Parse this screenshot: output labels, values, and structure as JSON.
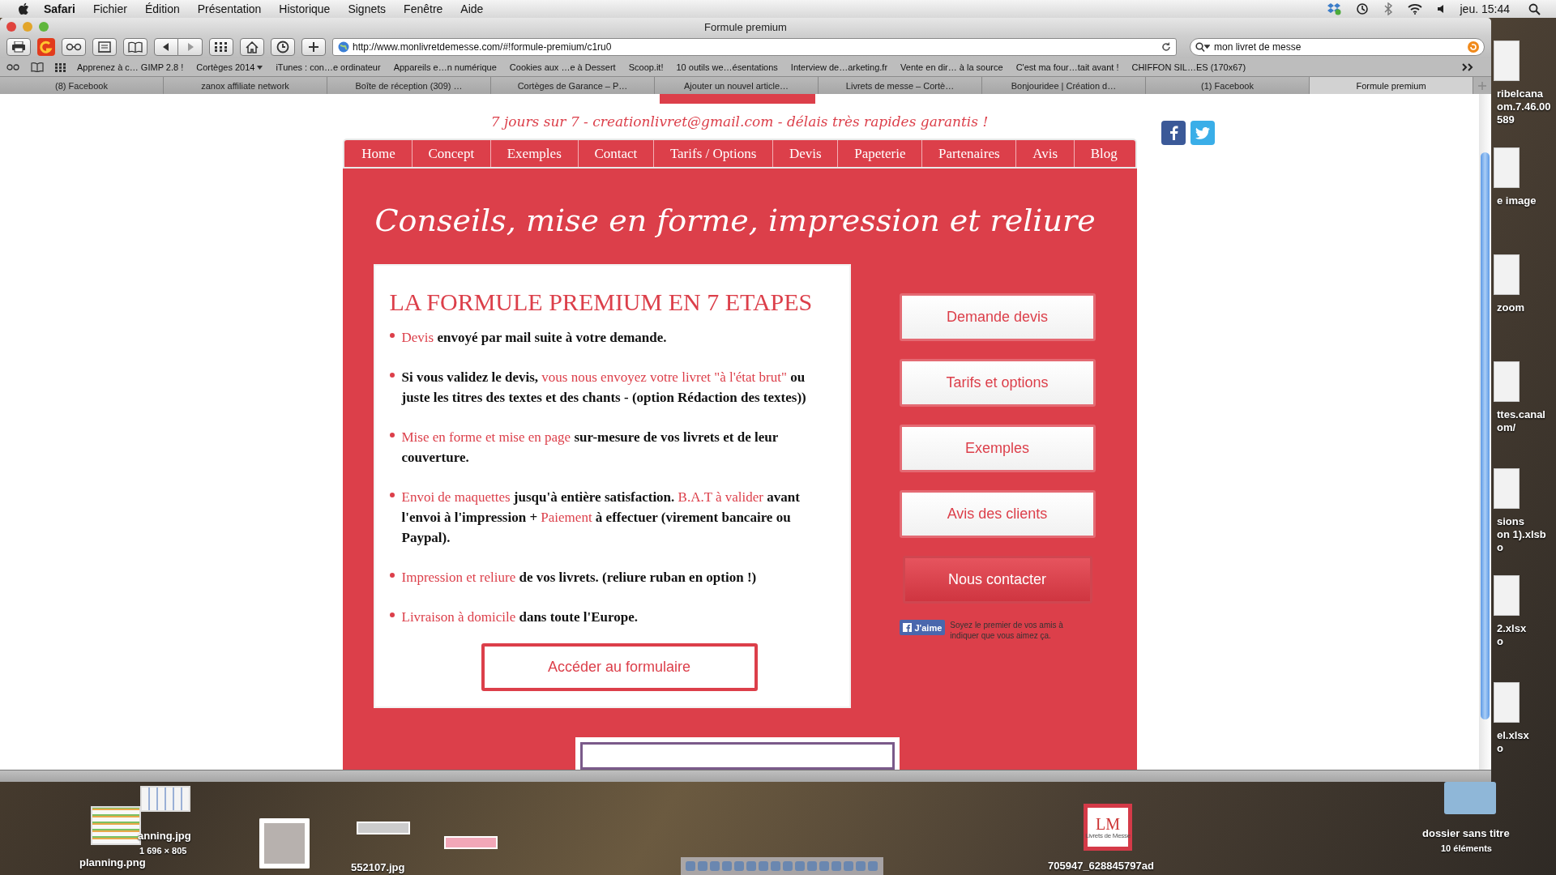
{
  "menubar": {
    "app": "Safari",
    "menus": [
      "Fichier",
      "Édition",
      "Présentation",
      "Historique",
      "Signets",
      "Fenêtre",
      "Aide"
    ],
    "clock": "jeu. 15:44"
  },
  "window": {
    "title": "Formule premium",
    "url": "http://www.monlivretdemesse.com/#!formule-premium/c1ru0",
    "search": "mon livret de messe",
    "bookmarks": [
      {
        "label": "Apprenez à c… GIMP 2.8 !",
        "folder": false
      },
      {
        "label": "Cortèges 2014",
        "folder": true
      },
      {
        "label": "iTunes : con…e ordinateur",
        "folder": false
      },
      {
        "label": "Appareils e…n numérique",
        "folder": false
      },
      {
        "label": "Cookies aux …e à Dessert",
        "folder": false
      },
      {
        "label": "Scoop.it!",
        "folder": false
      },
      {
        "label": "10 outils we…ésentations",
        "folder": false
      },
      {
        "label": "Interview de…arketing.fr",
        "folder": false
      },
      {
        "label": "Vente en dir… à la source",
        "folder": false
      },
      {
        "label": "C'est ma four…tait avant !",
        "folder": false
      },
      {
        "label": "CHIFFON SIL…ES (170x67)",
        "folder": false
      }
    ],
    "tabs": [
      {
        "label": "(8) Facebook",
        "selected": false
      },
      {
        "label": "zanox affiliate network",
        "selected": false
      },
      {
        "label": "Boîte de réception (309) …",
        "selected": false
      },
      {
        "label": "Cortèges de Garance – P…",
        "selected": false
      },
      {
        "label": "Ajouter un nouvel article…",
        "selected": false
      },
      {
        "label": "Livrets de messe – Cortè…",
        "selected": false
      },
      {
        "label": "Bonjouridee | Création d…",
        "selected": false
      },
      {
        "label": "(1) Facebook",
        "selected": false
      },
      {
        "label": "Formule premium",
        "selected": true
      }
    ]
  },
  "page": {
    "tagline": "7 jours sur 7 - creationlivret@gmail.com - délais très rapides garantis !",
    "nav": [
      "Home",
      "Concept",
      "Exemples",
      "Contact",
      "Tarifs / Options",
      "Devis",
      "Papeterie",
      "Partenaires",
      "Avis",
      "Blog"
    ],
    "heading": "Conseils, mise en forme, impression et reliure",
    "card": {
      "title": "LA FORMULE PREMIUM EN 7 ETAPES",
      "steps": [
        [
          {
            "text": "Devis",
            "highlight": true
          },
          {
            "text": " envoyé par mail suite à votre demande.",
            "highlight": false
          }
        ],
        [
          {
            "text": "Si vous validez le devis, ",
            "highlight": false
          },
          {
            "text": "vous nous envoyez votre livret \"à l'état brut\"",
            "highlight": true
          },
          {
            "text": " ou juste les titres des textes et des chants - (option Rédaction des textes))",
            "highlight": false
          }
        ],
        [
          {
            "text": "Mise en forme et mise en page",
            "highlight": true
          },
          {
            "text": " sur-mesure de vos livrets et de leur couverture.",
            "highlight": false
          }
        ],
        [
          {
            "text": "Envoi de maquettes",
            "highlight": true
          },
          {
            "text": " jusqu'à entière satisfaction. ",
            "highlight": false
          },
          {
            "text": "B.A.T à valider",
            "highlight": true
          },
          {
            "text": " avant l'envoi à l'impression + ",
            "highlight": false
          },
          {
            "text": "Paiement",
            "highlight": true
          },
          {
            "text": " à effectuer (virement bancaire ou Paypal).",
            "highlight": false
          }
        ],
        [
          {
            "text": "Impression et reliure",
            "highlight": true
          },
          {
            "text": " de vos livrets. (reliure ruban en option !)",
            "highlight": false
          }
        ],
        [
          {
            "text": "Livraison à domicile",
            "highlight": true
          },
          {
            "text": " dans toute l'Europe.",
            "highlight": false
          }
        ]
      ],
      "button": "Accéder au formulaire"
    },
    "side_buttons": [
      {
        "label": "Demande devis",
        "kind": "plain"
      },
      {
        "label": "Tarifs et options",
        "kind": "plain"
      },
      {
        "label": "Exemples",
        "kind": "plain"
      },
      {
        "label": "Avis des clients",
        "kind": "plain"
      },
      {
        "label": "Nous contacter",
        "kind": "filled"
      }
    ],
    "like": {
      "button": "J'aime",
      "text": "Soyez le premier de vos amis à indiquer que vous aimez ça."
    }
  },
  "desktop": {
    "right_icons": [
      [
        "ribelcana",
        "om.7.46.00",
        "589"
      ],
      [
        "e image"
      ],
      [
        "zoom"
      ],
      [
        "ttes.canal",
        "om/"
      ],
      [
        "sions",
        "on 1).xlsb",
        "o"
      ],
      [
        "2.xlsx",
        "o"
      ],
      [
        "el.xlsx",
        "o"
      ]
    ],
    "planning_jpg": [
      "anning.jpg",
      "1 696 × 805"
    ],
    "planning_png": "planning.png",
    "image_file": "552107.jpg",
    "logo": {
      "mark": "LM",
      "caption": "Livrets de Messe"
    },
    "logo_file": "705947_628845797ad",
    "folder": [
      "dossier sans titre",
      "10 éléments"
    ]
  }
}
